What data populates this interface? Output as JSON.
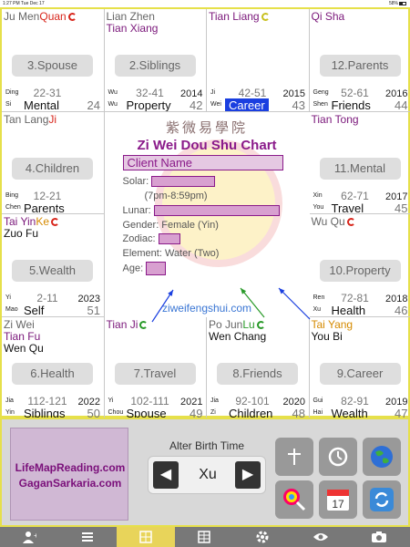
{
  "status_bar": {
    "time": "1:27 PM",
    "date": "Tue Dec 17",
    "battery": "58%"
  },
  "cells": [
    {
      "id": "c1",
      "stars": [
        {
          "parts": [
            {
              "t": "Ju Men",
              "c": "gray"
            },
            {
              "t": "Quan",
              "c": "red"
            }
          ],
          "cycle": "red"
        }
      ],
      "palace": "3.Spouse",
      "stem": "Ding",
      "branch": "Si",
      "range": "22-31",
      "year": "",
      "label": "Mental",
      "age": "24",
      "highlight": false
    },
    {
      "id": "c2",
      "stars": [
        {
          "parts": [
            {
              "t": "Lian Zhen",
              "c": "gray"
            }
          ]
        },
        {
          "parts": [
            {
              "t": "Tian Xiang",
              "c": "purple"
            }
          ]
        }
      ],
      "palace": "2.Siblings",
      "stem": "Wu",
      "branch": "Wu",
      "range": "32-41",
      "year": "2014",
      "label": "Property",
      "age": "42",
      "highlight": false
    },
    {
      "id": "c3",
      "stars": [
        {
          "parts": [
            {
              "t": "Tian Liang",
              "c": "purple"
            }
          ],
          "cycle": "yellow"
        }
      ],
      "palace": "",
      "stem": "Ji",
      "branch": "Wei",
      "range": "42-51",
      "year": "2015",
      "label": "Career",
      "age": "43",
      "highlight": true
    },
    {
      "id": "c4",
      "stars": [
        {
          "parts": [
            {
              "t": "Qi Sha",
              "c": "purple"
            }
          ]
        }
      ],
      "palace": "12.Parents",
      "stem": "Geng",
      "branch": "Shen",
      "range": "52-61",
      "year": "2016",
      "label": "Friends",
      "age": "44",
      "highlight": false
    },
    {
      "id": "c5",
      "stars": [
        {
          "parts": [
            {
              "t": "Tan Lang",
              "c": "gray"
            },
            {
              "t": "Ji",
              "c": "red"
            }
          ]
        }
      ],
      "palace": "4.Children",
      "stem": "Bing",
      "branch": "Chen",
      "range": "12-21",
      "year": "",
      "label": "Parents",
      "age": "",
      "highlight": false
    },
    {
      "id": "c6",
      "stars": [
        {
          "parts": [
            {
              "t": "Tian Tong",
              "c": "purple"
            }
          ]
        }
      ],
      "palace": "11.Mental",
      "stem": "Xin",
      "branch": "You",
      "range": "62-71",
      "year": "2017",
      "label": "Travel",
      "age": "45",
      "highlight": false
    },
    {
      "id": "c7",
      "stars": [
        {
          "parts": [
            {
              "t": "Tai Yin",
              "c": "purple"
            },
            {
              "t": "Ke",
              "c": "orange"
            }
          ],
          "cycle": "red"
        },
        {
          "parts": [
            {
              "t": "Zuo Fu",
              "c": "black"
            }
          ]
        }
      ],
      "palace": "5.Wealth",
      "stem": "Yi",
      "branch": "Mao",
      "range": "2-11",
      "year": "2023",
      "label": "Self",
      "age": "51",
      "highlight": false
    },
    {
      "id": "c8",
      "stars": [
        {
          "parts": [
            {
              "t": "Wu Qu",
              "c": "gray"
            }
          ],
          "cycle": "red"
        }
      ],
      "palace": "10.Property",
      "stem": "Ren",
      "branch": "Xu",
      "range": "72-81",
      "year": "2018",
      "label": "Health",
      "age": "46",
      "highlight": false
    },
    {
      "id": "c9",
      "stars": [
        {
          "parts": [
            {
              "t": "Zi Wei",
              "c": "gray"
            }
          ]
        },
        {
          "parts": [
            {
              "t": "Tian Fu",
              "c": "purple"
            }
          ]
        },
        {
          "parts": [
            {
              "t": "Wen Qu",
              "c": "black"
            }
          ]
        }
      ],
      "palace": "6.Health",
      "stem": "Jia",
      "branch": "Yin",
      "range": "112-121",
      "year": "2022",
      "label": "Siblings",
      "age": "50",
      "highlight": false
    },
    {
      "id": "c10",
      "stars": [
        {
          "parts": [
            {
              "t": "Tian Ji",
              "c": "purple"
            }
          ],
          "cycle": "green"
        }
      ],
      "palace": "7.Travel",
      "stem": "Yi",
      "branch": "Chou",
      "range": "102-111",
      "year": "2021",
      "label": "Spouse",
      "age": "49",
      "highlight": false
    },
    {
      "id": "c11",
      "stars": [
        {
          "parts": [
            {
              "t": "Po Jun",
              "c": "gray"
            },
            {
              "t": "Lu",
              "c": "green"
            }
          ],
          "cycle": "green"
        },
        {
          "parts": [
            {
              "t": "Wen Chang",
              "c": "black"
            }
          ]
        }
      ],
      "palace": "8.Friends",
      "stem": "Jia",
      "branch": "Zi",
      "range": "92-101",
      "year": "2020",
      "label": "Children",
      "age": "48",
      "highlight": false
    },
    {
      "id": "c12",
      "stars": [
        {
          "parts": [
            {
              "t": "Tai Yang",
              "c": "orange"
            }
          ]
        },
        {
          "parts": [
            {
              "t": "You Bi",
              "c": "black"
            }
          ]
        }
      ],
      "palace": "9.Career",
      "stem": "Gui",
      "branch": "Hai",
      "range": "82-91",
      "year": "2019",
      "label": "Wealth",
      "age": "47",
      "highlight": false
    }
  ],
  "center": {
    "cn_title": "紫微易學院",
    "en_title": "Zi Wei Dou Shu Chart",
    "client_name": "Client Name",
    "solar_label": "Solar:",
    "time_note": "(7pm-8:59pm)",
    "lunar_label": "Lunar:",
    "gender": "Gender: Female (Yin)",
    "zodiac_label": "Zodiac:",
    "element": "Element: Water (Two)",
    "age_label": "Age:"
  },
  "website": "ziweifengshui.com",
  "panel": {
    "logo_line1": "LifeMapReading.com",
    "logo_line2": "GaganSarkaria.com",
    "alter_label": "Alter Birth Time",
    "alter_value": "Xu",
    "prev_symbol": "◀",
    "next_symbol": "▶",
    "calendar_day": "17"
  },
  "icons": [
    "cross-icon",
    "history-icon",
    "globe-icon",
    "lollipop-icon",
    "calendar-icon",
    "refresh-icon"
  ],
  "tabs": [
    "add-user-icon",
    "list-icon",
    "chart-icon",
    "table-icon",
    "gear-icon",
    "eye-icon",
    "camera-icon"
  ],
  "colors": {
    "accent": "#e6e04a",
    "highlight": "#1a3fe0",
    "purple": "#7a177a",
    "link": "#3a76d4"
  }
}
